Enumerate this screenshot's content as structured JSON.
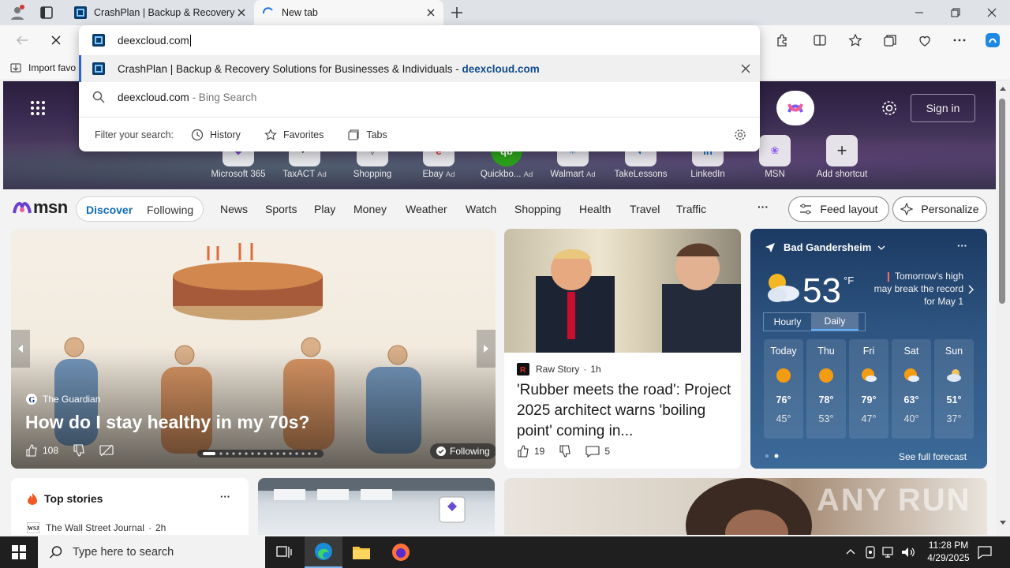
{
  "browser": {
    "tabs": [
      {
        "title": "CrashPlan | Backup & Recovery S"
      },
      {
        "title": "New tab"
      }
    ],
    "address_value": "deexcloud.com",
    "favorites_bar_item": "Import favo"
  },
  "omnibox": {
    "suggestions": [
      {
        "title": "CrashPlan | Backup & Recovery Solutions for Businesses & Individuals",
        "separator": " - ",
        "domain": "deexcloud.com"
      },
      {
        "title": "deexcloud.com",
        "hint": " - Bing Search"
      }
    ],
    "filter_label": "Filter your search:",
    "filters": [
      "History",
      "Favorites",
      "Tabs"
    ]
  },
  "ntp": {
    "signin_label": "Sign in",
    "shortcuts": [
      {
        "label": "Microsoft 365",
        "ad": ""
      },
      {
        "label": "TaxACT",
        "ad": "Ad"
      },
      {
        "label": "Shopping",
        "ad": ""
      },
      {
        "label": "Ebay",
        "ad": "Ad"
      },
      {
        "label": "Quickbo...",
        "ad": "Ad"
      },
      {
        "label": "Walmart",
        "ad": "Ad"
      },
      {
        "label": "TakeLessons",
        "ad": ""
      },
      {
        "label": "LinkedIn",
        "ad": ""
      },
      {
        "label": "MSN",
        "ad": ""
      },
      {
        "label": "Add shortcut",
        "ad": ""
      }
    ],
    "msn_logo": "msn",
    "pill": {
      "discover": "Discover",
      "following": "Following"
    },
    "nav": [
      "News",
      "Sports",
      "Play",
      "Money",
      "Weather",
      "Watch",
      "Shopping",
      "Health",
      "Travel",
      "Traffic"
    ],
    "more": "···",
    "feed_layout": "Feed layout",
    "personalize": "Personalize"
  },
  "feature": {
    "source": "The Guardian",
    "title": "How do I stay healthy in my 70s?",
    "likes": "108",
    "following": "Following"
  },
  "news2": {
    "source": "Raw Story",
    "age": "1h",
    "headline": "'Rubber meets the road': Project 2025 architect warns 'boiling point' coming in...",
    "likes": "19",
    "comments": "5"
  },
  "weather": {
    "location": "Bad Gandersheim",
    "temp": "53",
    "unit": "°F",
    "note": "Tomorrow's high may break the record for May 1",
    "tabs": [
      "Hourly",
      "Daily"
    ],
    "days": [
      {
        "name": "Today",
        "hi": "76°",
        "lo": "45°",
        "icon": "sun-icon"
      },
      {
        "name": "Thu",
        "hi": "78°",
        "lo": "53°",
        "icon": "sun-icon"
      },
      {
        "name": "Fri",
        "hi": "79°",
        "lo": "47°",
        "icon": "partly-cloudy-icon"
      },
      {
        "name": "Sat",
        "hi": "63°",
        "lo": "40°",
        "icon": "partly-cloudy-icon"
      },
      {
        "name": "Sun",
        "hi": "51°",
        "lo": "37°",
        "icon": "cloudy-icon"
      }
    ],
    "see_full": "See full forecast"
  },
  "top_stories": {
    "title": "Top stories",
    "first_source": "The Wall Street Journal",
    "first_age": "2h"
  },
  "watermark": "ANY RUN",
  "taskbar": {
    "search_placeholder": "Type here to search",
    "time": "11:28 PM",
    "date": "4/29/2025"
  },
  "colors": {
    "accent": "#0f6cbd",
    "omnibox_highlight": "#2b63c8",
    "taskbar": "#1f1f1f"
  }
}
